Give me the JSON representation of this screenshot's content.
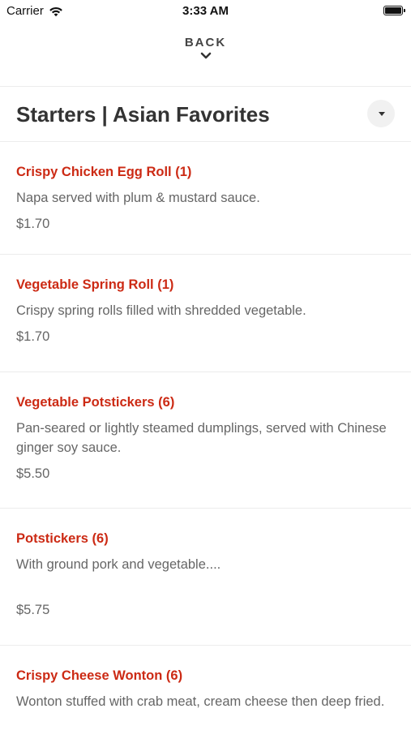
{
  "status_bar": {
    "carrier": "Carrier",
    "time": "3:33 AM"
  },
  "nav": {
    "back_label": "BACK"
  },
  "section": {
    "title": "Starters | Asian Favorites"
  },
  "items": [
    {
      "name": "Crispy Chicken Egg Roll (1)",
      "description": "Napa served with plum & mustard sauce.",
      "price": "$1.70"
    },
    {
      "name": "Vegetable Spring Roll (1)",
      "description": "Crispy spring rolls filled with shredded vegetable.",
      "price": "$1.70"
    },
    {
      "name": "Vegetable Potstickers (6)",
      "description": "Pan-seared or lightly steamed dumplings, served with Chinese ginger soy sauce.",
      "price": "$5.50"
    },
    {
      "name": "Potstickers (6)",
      "description": "With ground pork and vegetable....",
      "price": "$5.75"
    },
    {
      "name": "Crispy Cheese Wonton (6)",
      "description": "Wonton stuffed with crab meat, cream cheese then deep fried.",
      "price": ""
    }
  ],
  "colors": {
    "accent": "#cc2a14",
    "text": "#333333",
    "muted": "#666666"
  },
  "icons": {
    "wifi": "wifi-icon",
    "battery": "battery-icon",
    "back": "chevron-down-icon",
    "dropdown": "caret-down-icon"
  }
}
